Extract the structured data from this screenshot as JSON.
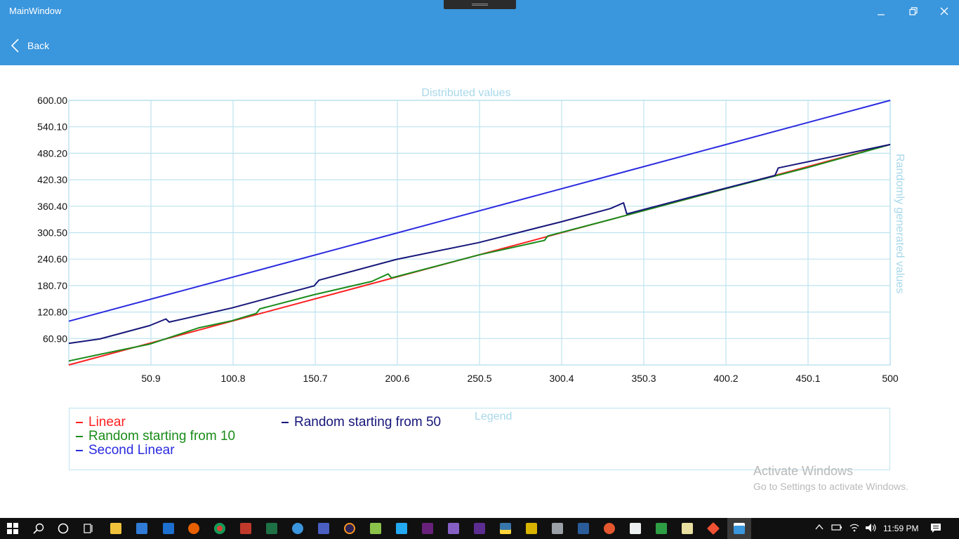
{
  "window": {
    "title": "MainWindow"
  },
  "header": {
    "back_label": "Back"
  },
  "colors": {
    "accent": "#3a96dd",
    "grid": "#bde3ef",
    "titles": "#a8d8ea"
  },
  "chart_data": {
    "type": "line",
    "title": "Distributed values",
    "y2label": "Randomly generated values",
    "xlim": [
      1,
      500
    ],
    "ylim": [
      1,
      600
    ],
    "x_ticks": [
      "50.9",
      "100.8",
      "150.7",
      "200.6",
      "250.5",
      "300.4",
      "350.3",
      "400.2",
      "450.1",
      "500"
    ],
    "y_ticks": [
      "60.90",
      "120.80",
      "180.70",
      "240.60",
      "300.50",
      "360.40",
      "420.30",
      "480.20",
      "540.10",
      "600.00"
    ],
    "grid": true,
    "legend": {
      "title": "Legend",
      "placement": "bottom"
    },
    "series": [
      {
        "name": "Linear",
        "color": "#ff2020",
        "x": [
          1,
          500
        ],
        "y": [
          1,
          500
        ]
      },
      {
        "name": "Random starting from 10",
        "color": "#1a8c1a",
        "x": [
          1,
          20,
          50,
          80,
          100,
          115,
          117,
          150,
          185,
          195,
          197,
          250,
          290,
          292,
          330,
          350,
          400,
          450,
          500
        ],
        "y": [
          10,
          25,
          48,
          85,
          101,
          118,
          128,
          160,
          190,
          207,
          198,
          250,
          283,
          293,
          330,
          350,
          400,
          448,
          500
        ]
      },
      {
        "name": "Second Linear",
        "color": "#2a2ae0",
        "x": [
          1,
          500
        ],
        "y": [
          100,
          600
        ]
      },
      {
        "name": "Random starting from 50",
        "color": "#16167a",
        "x": [
          1,
          20,
          50,
          60,
          62,
          100,
          150,
          153,
          200,
          250,
          300,
          330,
          338,
          340,
          380,
          430,
          432,
          500
        ],
        "y": [
          50,
          60,
          90,
          105,
          98,
          130,
          180,
          193,
          240,
          278,
          325,
          355,
          368,
          343,
          382,
          430,
          447,
          500
        ]
      }
    ]
  },
  "activation": {
    "line1": "Activate Windows",
    "line2": "Go to Settings to activate Windows."
  },
  "taskbar": {
    "time": "11:59 PM"
  }
}
